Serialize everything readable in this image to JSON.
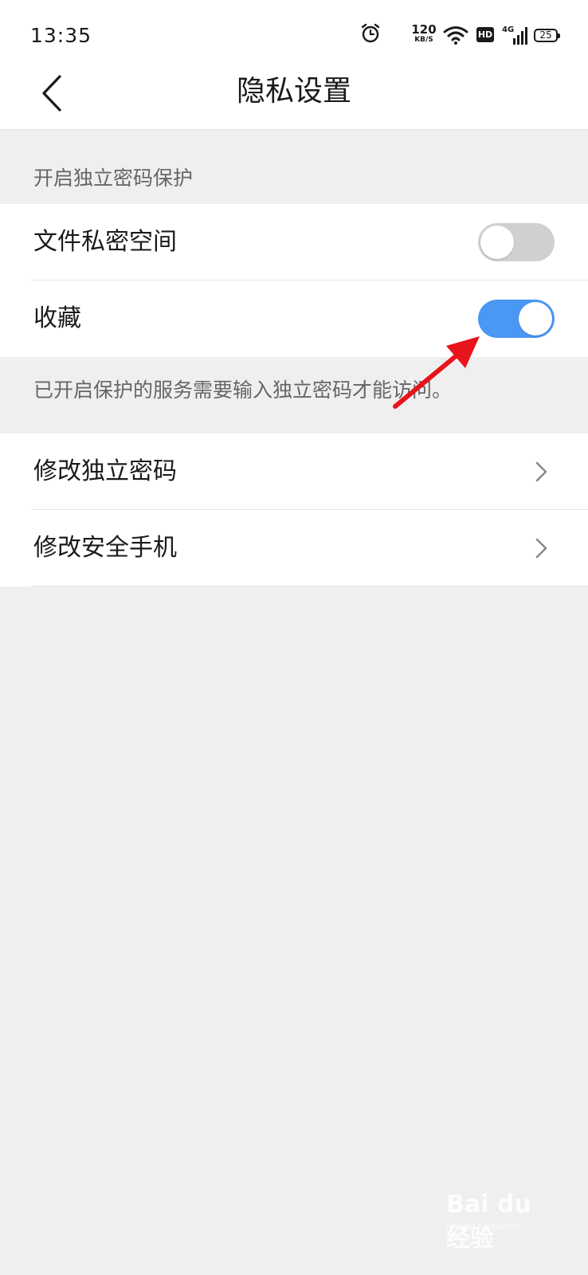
{
  "status_bar": {
    "time": "13:35",
    "speed_value": "120",
    "speed_unit": "KB/S",
    "hd_label": "HD",
    "network_label": "4G",
    "battery_level": "25"
  },
  "nav": {
    "title": "隐私设置"
  },
  "protection_section": {
    "header": "开启独立密码保护",
    "items": [
      {
        "label": "文件私密空间",
        "enabled": false
      },
      {
        "label": "收藏",
        "enabled": true
      }
    ],
    "hint": "已开启保护的服务需要输入独立密码才能访问。"
  },
  "account_section": {
    "items": [
      {
        "label": "修改独立密码"
      },
      {
        "label": "修改安全手机"
      }
    ]
  },
  "watermark": {
    "brand": "Bai du 经验",
    "sub": "jingyan.baidu.com"
  },
  "colors": {
    "toggle_on": "#4a97f4",
    "toggle_off": "#d0d0d0",
    "annotation_arrow": "#e8141b"
  }
}
